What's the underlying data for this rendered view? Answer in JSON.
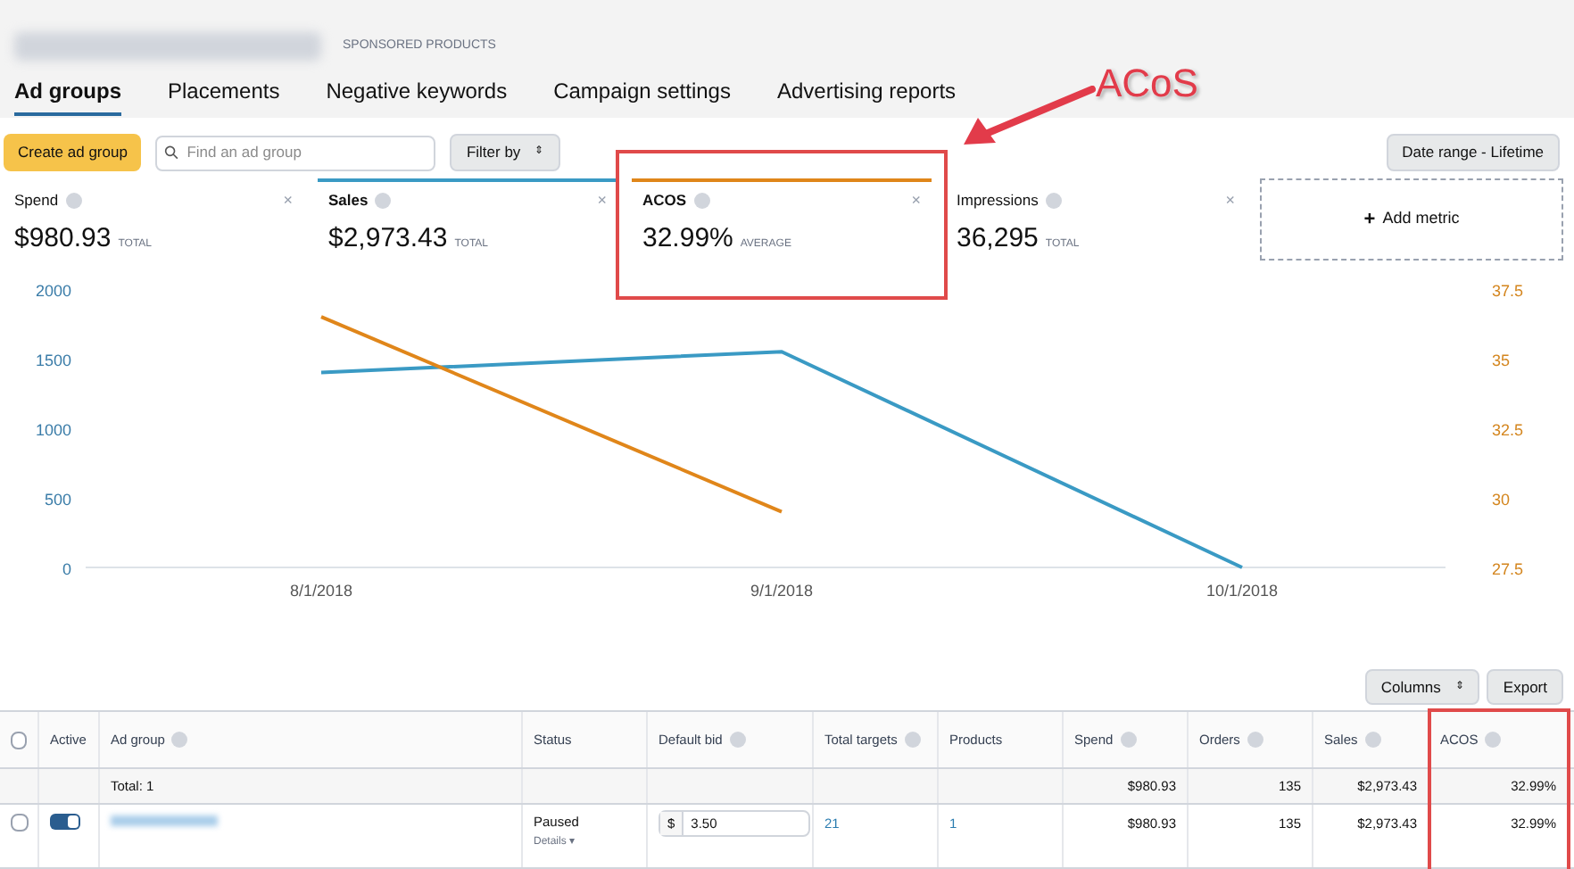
{
  "header": {
    "subtitle": "SPONSORED PRODUCTS"
  },
  "tabs": [
    {
      "label": "Ad groups",
      "selected": true
    },
    {
      "label": "Placements",
      "selected": false
    },
    {
      "label": "Negative keywords",
      "selected": false
    },
    {
      "label": "Campaign settings",
      "selected": false
    },
    {
      "label": "Advertising reports",
      "selected": false
    }
  ],
  "toolbar": {
    "create_button": "Create ad group",
    "search": {
      "placeholder": "Find an ad group"
    },
    "filter_button": "Filter by",
    "filter_caret": "⇕",
    "date_button": "Date range - Lifetime"
  },
  "metrics": [
    {
      "label": "Spend",
      "value": "$980.93",
      "unit": "TOTAL",
      "close": "×"
    },
    {
      "label": "Sales",
      "value": "$2,973.43",
      "unit": "TOTAL",
      "close": "×",
      "color": "#3a9ac4"
    },
    {
      "label": "ACOS",
      "value": "32.99%",
      "unit": "AVERAGE",
      "close": "×",
      "color": "#e0861a"
    },
    {
      "label": "Impressions",
      "value": "36,295",
      "unit": "TOTAL",
      "close": "×"
    }
  ],
  "add_metric": {
    "icon": "+",
    "label": "Add metric"
  },
  "chart": {
    "chart_data": {
      "type": "line",
      "x": [
        "8/1/2018",
        "9/1/2018",
        "10/1/2018"
      ],
      "ylim": [
        0,
        2000
      ],
      "yticks": [
        0,
        500,
        1000,
        1500,
        2000
      ],
      "y2lim": [
        27.5,
        37.5
      ],
      "y2ticks": [
        27.5,
        30,
        32.5,
        35,
        37.5
      ],
      "series": [
        {
          "color": "#3a9ac4",
          "values": [
            1400,
            1550,
            0
          ]
        },
        {
          "color": "#e0861a",
          "axis": "y2",
          "values": [
            36.5,
            29.5,
            null
          ]
        }
      ]
    }
  },
  "table_actions": {
    "columns_button": "Columns",
    "columns_caret": "⇕",
    "export_button": "Export"
  },
  "table": {
    "select_all": {
      "checked": false
    },
    "columns": [
      {
        "label": "Active",
        "info": false
      },
      {
        "label": "Ad group",
        "info": true
      },
      {
        "label": "Status",
        "info": false
      },
      {
        "label": "Default bid",
        "info": true
      },
      {
        "label": "Total targets",
        "info": true
      },
      {
        "label": "Products",
        "info": false
      },
      {
        "label": "Spend",
        "info": true
      },
      {
        "label": "Orders",
        "info": true
      },
      {
        "label": "Sales",
        "info": true
      },
      {
        "label": "ACOS",
        "info": true
      }
    ],
    "total_row": {
      "label": "Total: 1",
      "spend": "$980.93",
      "orders": "135",
      "sales": "$2,973.43",
      "acos": "32.99%"
    },
    "rows": [
      {
        "checked": false,
        "active": true,
        "status": "Paused",
        "details": "Details",
        "details_caret": "▾",
        "currency": "$",
        "bid": "3.50",
        "targets": "21",
        "products": "1",
        "spend": "$980.93",
        "orders": "135",
        "sales": "$2,973.43",
        "acos": "32.99%"
      }
    ]
  },
  "annotation": {
    "label": "ACoS"
  }
}
